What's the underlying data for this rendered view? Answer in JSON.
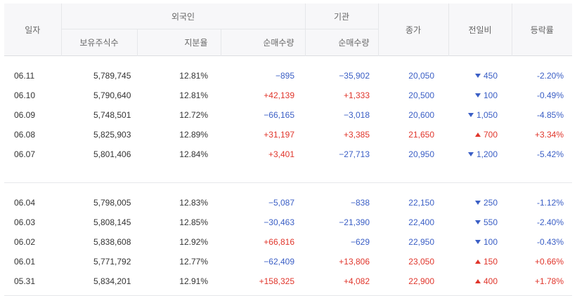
{
  "headers": {
    "date": "일자",
    "foreign_group": "외국인",
    "institution_group": "기관",
    "close": "종가",
    "change": "전일비",
    "rate": "등락률",
    "holdings": "보유주식수",
    "ratio": "지분율",
    "foreign_net": "순매수량",
    "institution_net": "순매수량"
  },
  "colors": {
    "up": "#e0352b",
    "down": "#3a5ec5",
    "header_bg": "#f7f7f9"
  },
  "groups": [
    {
      "rows": [
        {
          "date": "06.11",
          "holdings": "5,789,745",
          "ratio": "12.81%",
          "foreign_net": "−895",
          "foreign_dir": "down",
          "institution_net": "−35,902",
          "institution_dir": "down",
          "close": "20,050",
          "close_dir": "down",
          "change": "450",
          "change_dir": "down",
          "rate": "-2.20%",
          "rate_dir": "down"
        },
        {
          "date": "06.10",
          "holdings": "5,790,640",
          "ratio": "12.81%",
          "foreign_net": "+42,139",
          "foreign_dir": "up",
          "institution_net": "+1,333",
          "institution_dir": "up",
          "close": "20,500",
          "close_dir": "down",
          "change": "100",
          "change_dir": "down",
          "rate": "-0.49%",
          "rate_dir": "down"
        },
        {
          "date": "06.09",
          "holdings": "5,748,501",
          "ratio": "12.72%",
          "foreign_net": "−66,165",
          "foreign_dir": "down",
          "institution_net": "−3,018",
          "institution_dir": "down",
          "close": "20,600",
          "close_dir": "down",
          "change": "1,050",
          "change_dir": "down",
          "rate": "-4.85%",
          "rate_dir": "down"
        },
        {
          "date": "06.08",
          "holdings": "5,825,903",
          "ratio": "12.89%",
          "foreign_net": "+31,197",
          "foreign_dir": "up",
          "institution_net": "+3,385",
          "institution_dir": "up",
          "close": "21,650",
          "close_dir": "up",
          "change": "700",
          "change_dir": "up",
          "rate": "+3.34%",
          "rate_dir": "up"
        },
        {
          "date": "06.07",
          "holdings": "5,801,406",
          "ratio": "12.84%",
          "foreign_net": "+3,401",
          "foreign_dir": "up",
          "institution_net": "−27,713",
          "institution_dir": "down",
          "close": "20,950",
          "close_dir": "down",
          "change": "1,200",
          "change_dir": "down",
          "rate": "-5.42%",
          "rate_dir": "down"
        }
      ]
    },
    {
      "rows": [
        {
          "date": "06.04",
          "holdings": "5,798,005",
          "ratio": "12.83%",
          "foreign_net": "−5,087",
          "foreign_dir": "down",
          "institution_net": "−838",
          "institution_dir": "down",
          "close": "22,150",
          "close_dir": "down",
          "change": "250",
          "change_dir": "down",
          "rate": "-1.12%",
          "rate_dir": "down"
        },
        {
          "date": "06.03",
          "holdings": "5,808,145",
          "ratio": "12.85%",
          "foreign_net": "−30,463",
          "foreign_dir": "down",
          "institution_net": "−21,390",
          "institution_dir": "down",
          "close": "22,400",
          "close_dir": "down",
          "change": "550",
          "change_dir": "down",
          "rate": "-2.40%",
          "rate_dir": "down"
        },
        {
          "date": "06.02",
          "holdings": "5,838,608",
          "ratio": "12.92%",
          "foreign_net": "+66,816",
          "foreign_dir": "up",
          "institution_net": "−629",
          "institution_dir": "down",
          "close": "22,950",
          "close_dir": "down",
          "change": "100",
          "change_dir": "down",
          "rate": "-0.43%",
          "rate_dir": "down"
        },
        {
          "date": "06.01",
          "holdings": "5,771,792",
          "ratio": "12.77%",
          "foreign_net": "−62,409",
          "foreign_dir": "down",
          "institution_net": "+13,806",
          "institution_dir": "up",
          "close": "23,050",
          "close_dir": "up",
          "change": "150",
          "change_dir": "up",
          "rate": "+0.66%",
          "rate_dir": "up"
        },
        {
          "date": "05.31",
          "holdings": "5,834,201",
          "ratio": "12.91%",
          "foreign_net": "+158,325",
          "foreign_dir": "up",
          "institution_net": "+4,082",
          "institution_dir": "up",
          "close": "22,900",
          "close_dir": "up",
          "change": "400",
          "change_dir": "up",
          "rate": "+1.78%",
          "rate_dir": "up"
        }
      ]
    }
  ]
}
